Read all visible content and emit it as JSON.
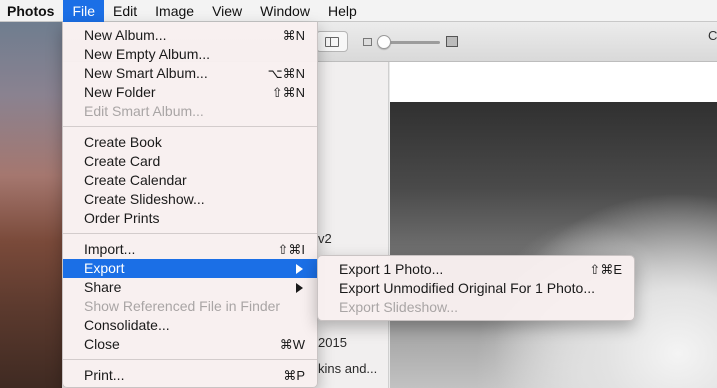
{
  "menubar": {
    "app": "Photos",
    "items": [
      "File",
      "Edit",
      "Image",
      "View",
      "Window",
      "Help"
    ]
  },
  "toolbar": {
    "right_text": "C"
  },
  "sidebar_fragments": {
    "v2": "v2",
    "year": "2015",
    "truncated": "kins and..."
  },
  "file_menu": {
    "new_album": "New Album...",
    "new_album_shortcut": "⌘N",
    "new_empty_album": "New Empty Album...",
    "new_smart_album": "New Smart Album...",
    "new_smart_album_shortcut": "⌥⌘N",
    "new_folder": "New Folder",
    "new_folder_shortcut": "⇧⌘N",
    "edit_smart_album": "Edit Smart Album...",
    "create_book": "Create Book",
    "create_card": "Create Card",
    "create_calendar": "Create Calendar",
    "create_slideshow": "Create Slideshow...",
    "order_prints": "Order Prints",
    "import": "Import...",
    "import_shortcut": "⇧⌘I",
    "export": "Export",
    "share": "Share",
    "show_referenced_file": "Show Referenced File in Finder",
    "consolidate": "Consolidate...",
    "close": "Close",
    "close_shortcut": "⌘W",
    "print": "Print...",
    "print_shortcut": "⌘P"
  },
  "export_submenu": {
    "export_photo": "Export 1 Photo...",
    "export_photo_shortcut": "⇧⌘E",
    "export_unmodified": "Export Unmodified Original For 1 Photo...",
    "export_slideshow": "Export Slideshow..."
  },
  "colors": {
    "highlight": "#1b6fe6",
    "disabled_text": "#a9a5a5"
  }
}
